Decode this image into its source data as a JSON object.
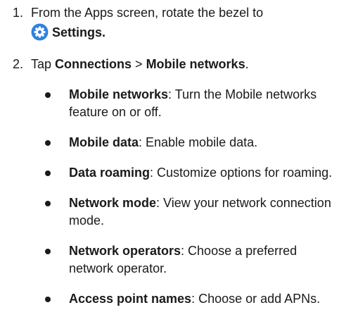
{
  "steps": [
    {
      "number": "1.",
      "text": "From the Apps screen, rotate the bezel to",
      "settings_label": "Settings.",
      "icon": "settings-gear-icon"
    },
    {
      "number": "2.",
      "prefix": "Tap ",
      "connections": "Connections",
      "separator": " > ",
      "mobile_networks": "Mobile networks",
      "suffix": "."
    }
  ],
  "bullets": [
    {
      "term": "Mobile networks",
      "desc": ": Turn the Mobile networks feature on or off."
    },
    {
      "term": "Mobile data",
      "desc": ": Enable mobile data."
    },
    {
      "term": "Data roaming",
      "desc": ": Customize options for roaming."
    },
    {
      "term": "Network mode",
      "desc": ": View your network connection mode."
    },
    {
      "term": "Network operators",
      "desc": ": Choose a preferred network operator."
    },
    {
      "term": "Access point names",
      "desc": ": Choose or add APNs."
    }
  ],
  "colors": {
    "icon_blue": "#2f7fe0",
    "text": "#1a1a1a"
  }
}
